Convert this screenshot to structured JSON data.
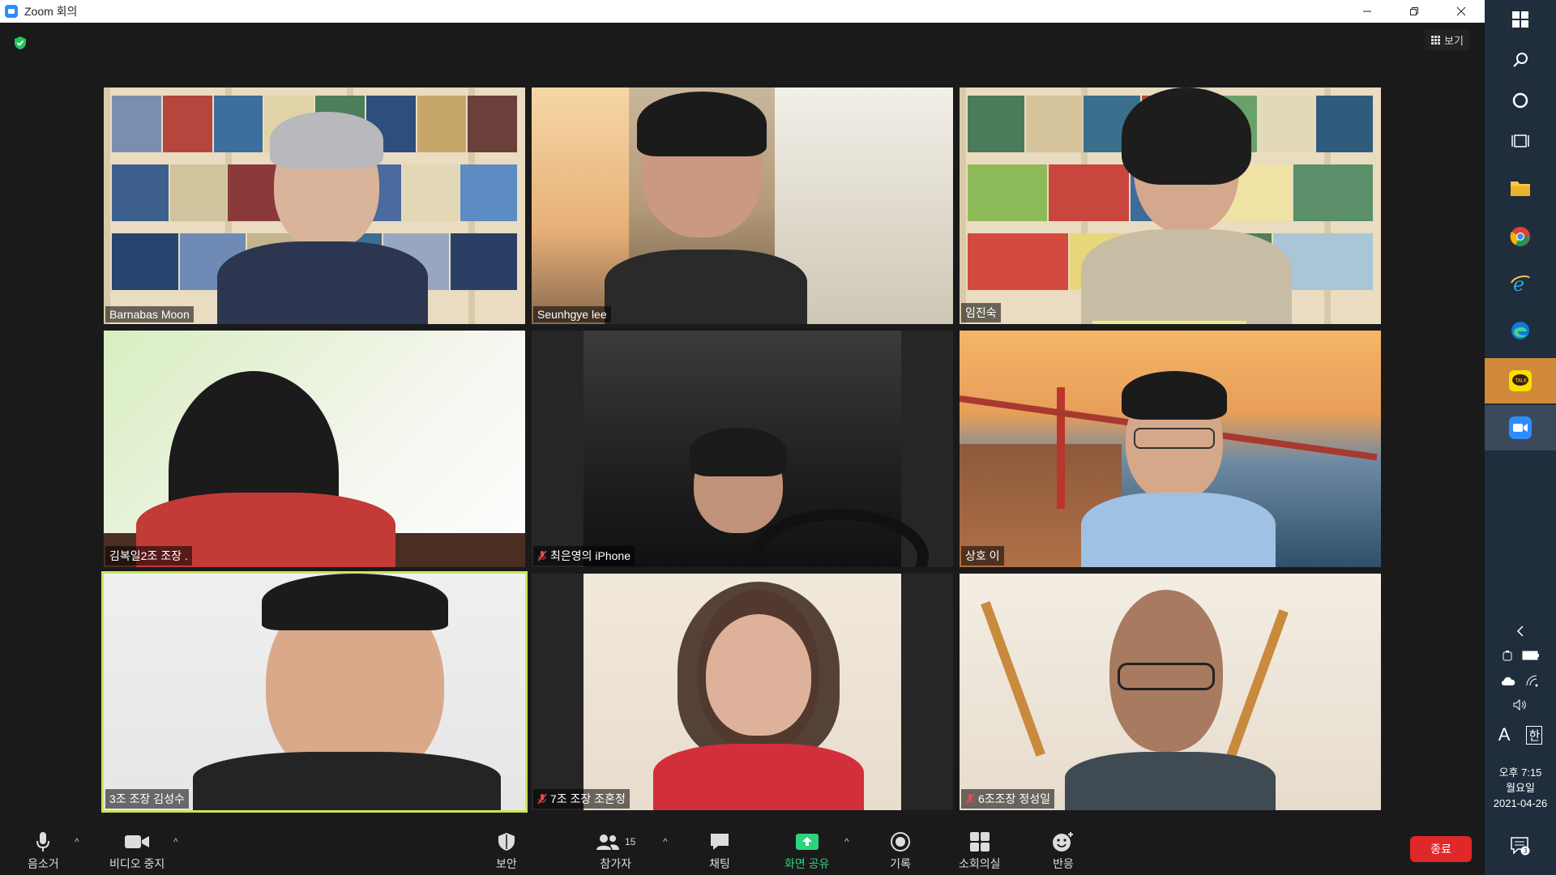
{
  "window": {
    "title": "Zoom 회의"
  },
  "view": {
    "label": "보기"
  },
  "participants": [
    {
      "name": "Barnabas Moon",
      "muted": false
    },
    {
      "name": "Seunhgye lee",
      "muted": false
    },
    {
      "name": "임진숙",
      "muted": false
    },
    {
      "name": "김복일2조 조장 .",
      "muted": false
    },
    {
      "name": "최은영의 iPhone",
      "muted": true
    },
    {
      "name": "상호 이",
      "muted": false
    },
    {
      "name": "3조 조장 김성수",
      "muted": false
    },
    {
      "name": "7조 조장 조혼정",
      "muted": true
    },
    {
      "name": "6조조장 정성일",
      "muted": true
    }
  ],
  "toolbar": {
    "mute": "음소거",
    "video": "비디오 중지",
    "security": "보안",
    "participants": "참가자",
    "participants_count": "15",
    "chat": "채팅",
    "share": "화면 공유",
    "record": "기록",
    "breakout": "소회의실",
    "reactions": "반응",
    "end": "종료"
  },
  "taskbar": {
    "ime_lang": "A",
    "ime_mode": "한",
    "clock_ampm_time": "오후 7:15",
    "clock_day": "월요일",
    "clock_date": "2021-04-26",
    "notification_count": "3"
  },
  "colors": {
    "accent_green": "#2fd27c",
    "end_red": "#e02828",
    "active_speaker": "#c8e65a",
    "zoom_blue": "#2d8cff"
  }
}
